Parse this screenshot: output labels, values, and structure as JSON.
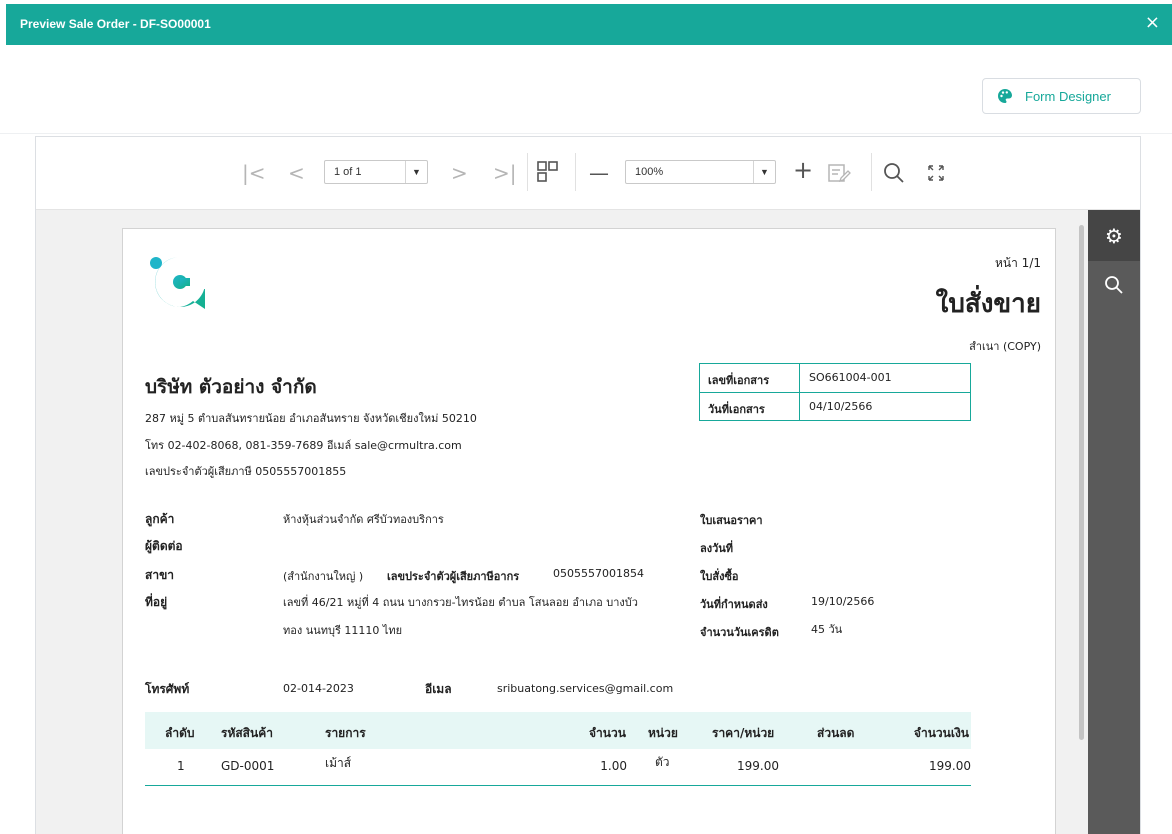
{
  "dialog": {
    "title": "Preview Sale Order - DF-SO00001",
    "close_icon": "×"
  },
  "form_designer": {
    "label": "Form Designer",
    "icon": "palette-icon"
  },
  "toolbar": {
    "page_select": "1 of 1",
    "zoom_select": "100%",
    "icons": [
      "first-page-icon",
      "prev-page-icon",
      "next-page-icon",
      "last-page-icon",
      "multi-page-icon",
      "zoom-out-icon",
      "zoom-in-icon",
      "edit-icon",
      "search-icon",
      "fullscreen-icon"
    ]
  },
  "side_panel": {
    "icons": [
      "settings-icon",
      "search-icon"
    ]
  },
  "doc": {
    "page_label": "หน้า 1/1",
    "doc_title": "ใบสั่งขาย",
    "copy_label": "สำเนา (COPY)",
    "company_name": "บริษัท ตัวอย่าง จำกัด",
    "company_address": "287 หมู่ 5 ตำบลสันทรายน้อย อำเภอสันทราย จังหวัดเชียงใหม่ 50210",
    "company_contact": "โทร 02-402-8068, 081-359-7689 อีเมล์ sale@crmultra.com",
    "company_tax": "เลขประจำตัวผู้เสียภาษี 0505557001855",
    "doc_no_label": "เลขที่เอกสาร",
    "doc_no": "SO661004-001",
    "doc_date_label": "วันที่เอกสาร",
    "doc_date": "04/10/2566",
    "customer_label": "ลูกค้า",
    "customer": "ห้างหุ้นส่วนจำกัด ศรีบัวทองบริการ",
    "contact_label": "ผู้ติดต่อ",
    "branch_label": "สาขา",
    "branch": "(สำนักงานใหญ่ )",
    "tax_label": "เลขประจำตัวผู้เสียภาษีอากร",
    "tax_no": "0505557001854",
    "address_label": "ที่อยู่",
    "address_line1": "เลขที่ 46/21 หมู่ที่ 4 ถนน บางกรวย-ไทรน้อย ตำบล โสนลอย อำเภอ บางบัว",
    "address_line2": "ทอง นนทบุรี 11110 ไทย",
    "quotation_label": "ใบเสนอราคา",
    "dated_label": "ลงวันที่",
    "po_label": "ใบสั่งซื้อ",
    "due_label": "วันที่กำหนดส่ง",
    "due_date": "19/10/2566",
    "credit_label": "จำนวนวันเครดิต",
    "credit_days": "45 วัน",
    "phone_label": "โทรศัพท์",
    "phone": "02-014-2023",
    "email_label": "อีเมล",
    "email": "sribuatong.services@gmail.com"
  },
  "table": {
    "headers": [
      "ลำดับ",
      "รหัสสินค้า",
      "รายการ",
      "จำนวน",
      "หน่วย",
      "ราคา/หน่วย",
      "ส่วนลด",
      "จำนวนเงิน"
    ],
    "rows": [
      {
        "no": "1",
        "code": "GD-0001",
        "item": "เม้าส์",
        "qty": "1.00",
        "unit": "ตัว",
        "price": "199.00",
        "discount": "",
        "amount": "199.00"
      }
    ]
  },
  "colors": {
    "accent": "#17a89a",
    "side_panel": "#5a5a5a"
  }
}
